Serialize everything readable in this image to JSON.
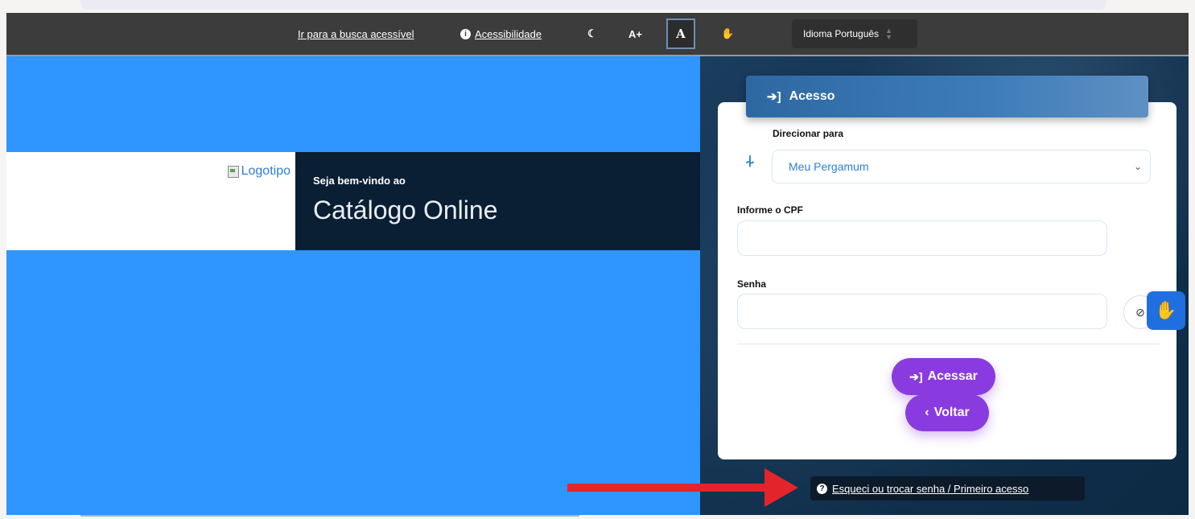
{
  "toolbar": {
    "skip_link": "Ir para a busca acessível",
    "accessibility": "Acessibilidade",
    "contrast_icon": "moon-icon",
    "font_increase": "A+",
    "font_normal": "A",
    "libras_icon": "hand-icon",
    "language": "Idioma Português"
  },
  "hero": {
    "logo_alt": "Logotipo",
    "welcome": "Seja bem-vindo ao",
    "title": "Catálogo Online"
  },
  "login": {
    "header": "Acesso",
    "redirect_label": "Direcionar para",
    "redirect_value": "Meu Pergamum",
    "cpf_label": "Informe o CPF",
    "cpf_value": "",
    "password_label": "Senha",
    "password_value": "",
    "submit": "Acessar",
    "back": "Voltar",
    "forgot": "Esqueci ou trocar senha / Primeiro acesso"
  },
  "colors": {
    "accent_blue": "#2f95ff",
    "button_purple": "#8a3be0",
    "arrow_red": "#e3242b"
  }
}
